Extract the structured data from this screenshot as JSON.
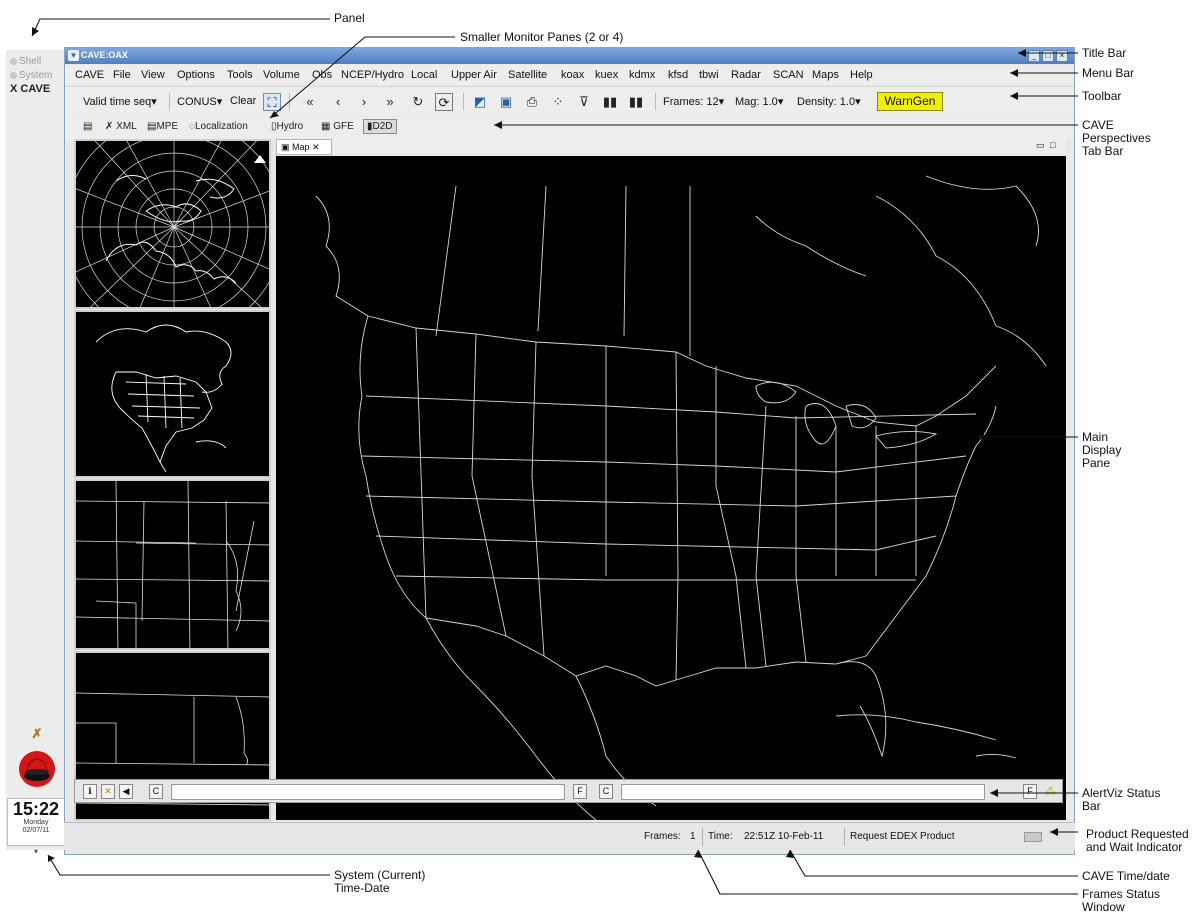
{
  "callouts": {
    "panel": "Panel",
    "smaller_panes": "Smaller Monitor Panes (2 or 4)",
    "title_bar": "Title Bar",
    "menu_bar": "Menu Bar",
    "toolbar": "Toolbar",
    "perspectives": "CAVE Perspectives Tab Bar",
    "main_display": "Main Display Pane",
    "alertviz": "AlertViz Status Bar",
    "product_requested": "Product Requested and Wait Indicator",
    "cave_time": "CAVE Time/date",
    "frames_status": "Frames Status Window",
    "system_time": "System (Current) Time-Date"
  },
  "panel": {
    "items": [
      "Shell",
      "System",
      "CAVE"
    ],
    "clock_time": "15:22",
    "clock_day": "Monday",
    "clock_date": "02/07/11"
  },
  "window": {
    "title": "CAVE:OAX",
    "min_glyph": "_",
    "max_glyph": "□",
    "close_glyph": "×"
  },
  "menu": [
    "CAVE",
    "File",
    "View",
    "Options",
    "Tools",
    "Volume",
    "Obs",
    "NCEP/Hydro",
    "Local",
    "Upper Air",
    "Satellite",
    "koax",
    "kuex",
    "kdmx",
    "kfsd",
    "tbwi",
    "Radar",
    "SCAN",
    "Maps",
    "Help"
  ],
  "toolbar": {
    "valid_time": "Valid time seq",
    "conus": "CONUS",
    "clear": "Clear",
    "frames": "Frames: 12",
    "mag": "Mag: 1.0",
    "density": "Density: 1.0",
    "warngen": "WarnGen",
    "dropdown_glyph": "▾"
  },
  "perspectives": [
    "XML",
    "MPE",
    "Localization",
    "Hydro",
    "GFE",
    "D2D"
  ],
  "map_tab": {
    "label": "Map"
  },
  "alertviz": {
    "button_c": "C",
    "button_f": "F"
  },
  "statusbar": {
    "frames_label": "Frames:",
    "frames_value": "1",
    "time_label": "Time:",
    "time_value": "22:51Z 10-Feb-11",
    "request": "Request EDEX Product"
  },
  "colors": {
    "titlebar": "#5b8acb",
    "warngen_bg": "#f2ee00",
    "map_bg": "#000000",
    "map_lines": "#d8d8d8"
  },
  "icons": [
    "first-frame-icon",
    "prev-frame-icon",
    "next-frame-icon",
    "last-frame-icon",
    "loop-icon",
    "refresh-icon",
    "zoom-icon",
    "print-icon",
    "sample-icon",
    "cursor-icon",
    "panel-layout-icon"
  ]
}
